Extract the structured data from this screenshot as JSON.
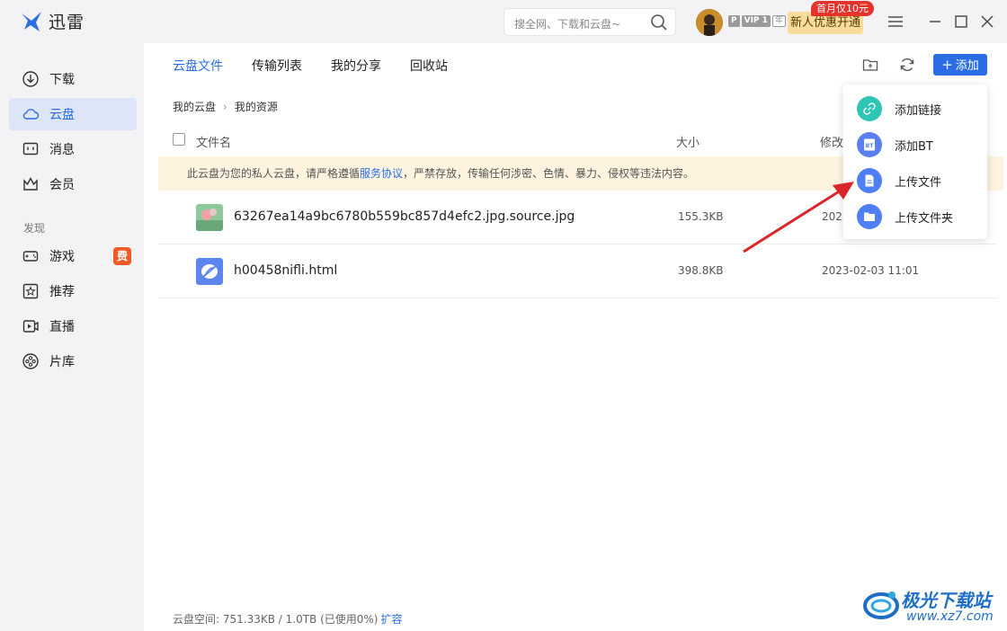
{
  "app": {
    "title": "迅雷"
  },
  "search": {
    "placeholder": "搜全网、下载和云盘~"
  },
  "user": {
    "vip_badge_p": "P",
    "vip_badge_level": "VIP 1",
    "vip_badge_year": "年",
    "promo_label": "新人优惠开通",
    "promo_tag": "首月仅10元"
  },
  "sidebar": {
    "items": [
      {
        "label": "下载",
        "icon": "download-icon"
      },
      {
        "label": "云盘",
        "icon": "cloud-icon",
        "active": true
      },
      {
        "label": "消息",
        "icon": "message-icon"
      },
      {
        "label": "会员",
        "icon": "crown-icon"
      }
    ],
    "section_label": "发现",
    "discover": [
      {
        "label": "游戏",
        "icon": "gamepad-icon",
        "badge": "费"
      },
      {
        "label": "推荐",
        "icon": "star-icon"
      },
      {
        "label": "直播",
        "icon": "live-icon"
      },
      {
        "label": "片库",
        "icon": "film-reel-icon"
      }
    ]
  },
  "tabs": [
    {
      "label": "云盘文件",
      "active": true
    },
    {
      "label": "传输列表"
    },
    {
      "label": "我的分享"
    },
    {
      "label": "回收站"
    }
  ],
  "toolbar": {
    "add_label": "添加"
  },
  "breadcrumb": [
    "我的云盘",
    "我的资源"
  ],
  "table": {
    "headers": {
      "name": "文件名",
      "size": "大小",
      "modified": "修改"
    },
    "notice_prefix": "此云盘为您的私人云盘，请严格遵循",
    "notice_link": "服务协议",
    "notice_suffix": "，严禁存放，传输任何涉密、色情、暴力、侵权等违法内容。",
    "rows": [
      {
        "name": "63267ea14a9bc6780b559bc857d4efc2.jpg.source.jpg",
        "size": "155.3KB",
        "date": "2023",
        "type": "image"
      },
      {
        "name": "h00458nifli.html",
        "size": "398.8KB",
        "date": "2023-02-03 11:01",
        "type": "html"
      }
    ]
  },
  "dropdown": {
    "items": [
      {
        "label": "添加链接",
        "icon": "link-icon",
        "color": "#2ec4b6"
      },
      {
        "label": "添加BT",
        "icon": "bt-icon",
        "color": "#5b7ff0"
      },
      {
        "label": "上传文件",
        "icon": "file-icon",
        "color": "#4f7ff5"
      },
      {
        "label": "上传文件夹",
        "icon": "folder-icon",
        "color": "#4f7ff5"
      }
    ]
  },
  "footer": {
    "space_text": "云盘空间: 751.33KB / 1.0TB (已使用0%)",
    "expand_link": "扩容"
  },
  "watermark": {
    "text": "极光下载站",
    "url": "www.xz7.com"
  },
  "colors": {
    "accent": "#2b6de5",
    "sidebar_bg": "#f3f3f5",
    "notice_bg": "#fdf3de",
    "arrow": "#d9262b"
  }
}
